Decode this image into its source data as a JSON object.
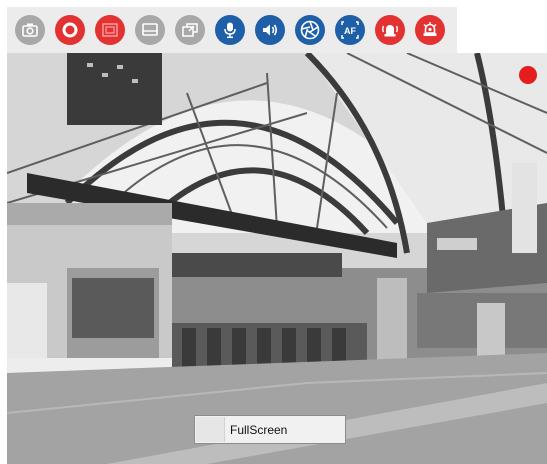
{
  "toolbar": {
    "buttons": [
      {
        "name": "snapshot-button",
        "icon": "camera-icon",
        "color": "#a8a8a8"
      },
      {
        "name": "record-button",
        "icon": "record-circle-icon",
        "color": "#e33232"
      },
      {
        "name": "zoom-region-button",
        "icon": "zoom-rectangle-icon",
        "color": "#e33232"
      },
      {
        "name": "display-button",
        "icon": "monitor-icon",
        "color": "#a8a8a8"
      },
      {
        "name": "window-button",
        "icon": "window-restore-icon",
        "color": "#a8a8a8"
      },
      {
        "name": "microphone-button",
        "icon": "microphone-icon",
        "color": "#1f5fa8"
      },
      {
        "name": "speaker-button",
        "icon": "speaker-icon",
        "color": "#1f5fa8"
      },
      {
        "name": "iris-button",
        "icon": "aperture-icon",
        "color": "#1f5fa8"
      },
      {
        "name": "autofocus-button",
        "icon": "autofocus-icon",
        "color": "#1f5fa8",
        "label": "AF"
      },
      {
        "name": "alarm-button",
        "icon": "alarm-icon",
        "color": "#e33232"
      },
      {
        "name": "siren-button",
        "icon": "siren-icon",
        "color": "#e33232"
      }
    ]
  },
  "video": {
    "recording_indicator_color": "#e51d1d"
  },
  "context_menu": {
    "item_label": "FullScreen"
  }
}
